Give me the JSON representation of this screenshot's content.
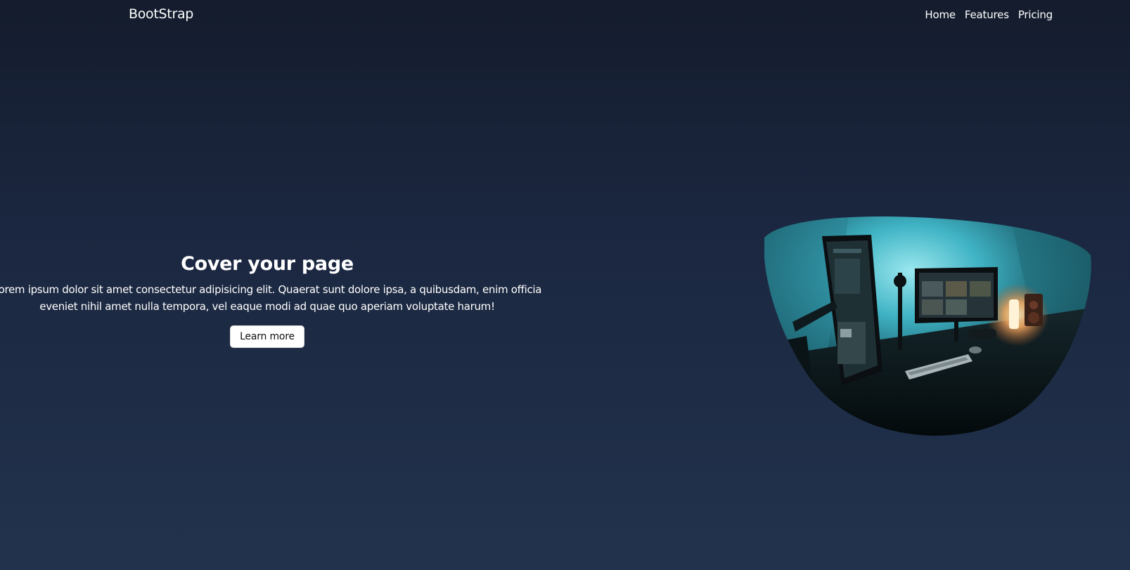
{
  "nav": {
    "brand": "BootStrap",
    "links": [
      "Home",
      "Features",
      "Pricing"
    ]
  },
  "hero": {
    "title": "Cover your page",
    "text": "Lorem ipsum dolor sit amet consectetur adipisicing elit. Quaerat sunt dolore ipsa, a quibusdam, enim officia eveniet nihil amet nulla tempora, vel eaque modi ad quae quo aperiam voluptate harum!",
    "button_label": "Learn more"
  },
  "image": {
    "description_icon": "desk-setup-photo"
  },
  "colors": {
    "background_top": "#141c2d",
    "background_bottom": "#22324d",
    "button_bg": "#ffffff",
    "glow": "#3fc3d6"
  }
}
